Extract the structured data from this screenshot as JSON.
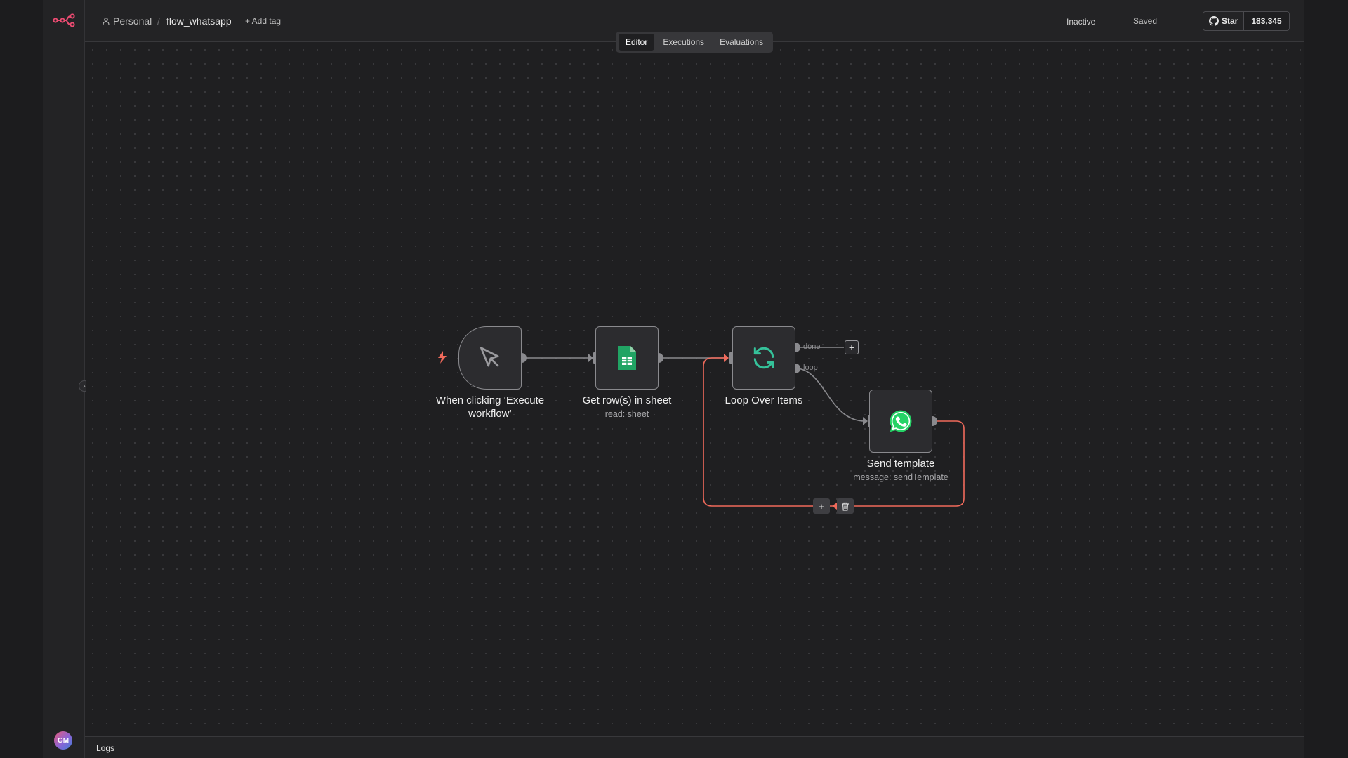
{
  "header": {
    "project": "Personal",
    "separator": "/",
    "workflow_name": "flow_whatsapp",
    "add_tag": "+ Add tag",
    "status": "Inactive",
    "save_state": "Saved",
    "star_label": "Star",
    "star_count": "183,345"
  },
  "tabs": [
    {
      "label": "Editor",
      "active": true
    },
    {
      "label": "Executions",
      "active": false
    },
    {
      "label": "Evaluations",
      "active": false
    }
  ],
  "nodes": {
    "trigger": {
      "title": "When clicking ‘Execute workflow’"
    },
    "sheets": {
      "title": "Get row(s) in sheet",
      "subtitle": "read: sheet"
    },
    "loop": {
      "title": "Loop Over Items",
      "out_done": "done",
      "out_loop": "loop"
    },
    "whatsapp": {
      "title": "Send template",
      "subtitle": "message: sendTemplate"
    }
  },
  "user": {
    "initials": "GM"
  },
  "logs": {
    "label": "Logs"
  },
  "colors": {
    "accent": "#ea4b71",
    "edge_highlight": "#f06a5b",
    "sheets_green": "#21a464",
    "whatsapp_green": "#25d366",
    "loop_teal": "#35c29a"
  },
  "icons": [
    "n8n-logo",
    "person-icon",
    "github-icon",
    "cursor-icon",
    "google-sheets-icon",
    "refresh-loop-icon",
    "whatsapp-icon",
    "bolt-icon",
    "plus-icon",
    "trash-icon",
    "chevron-right-icon"
  ]
}
